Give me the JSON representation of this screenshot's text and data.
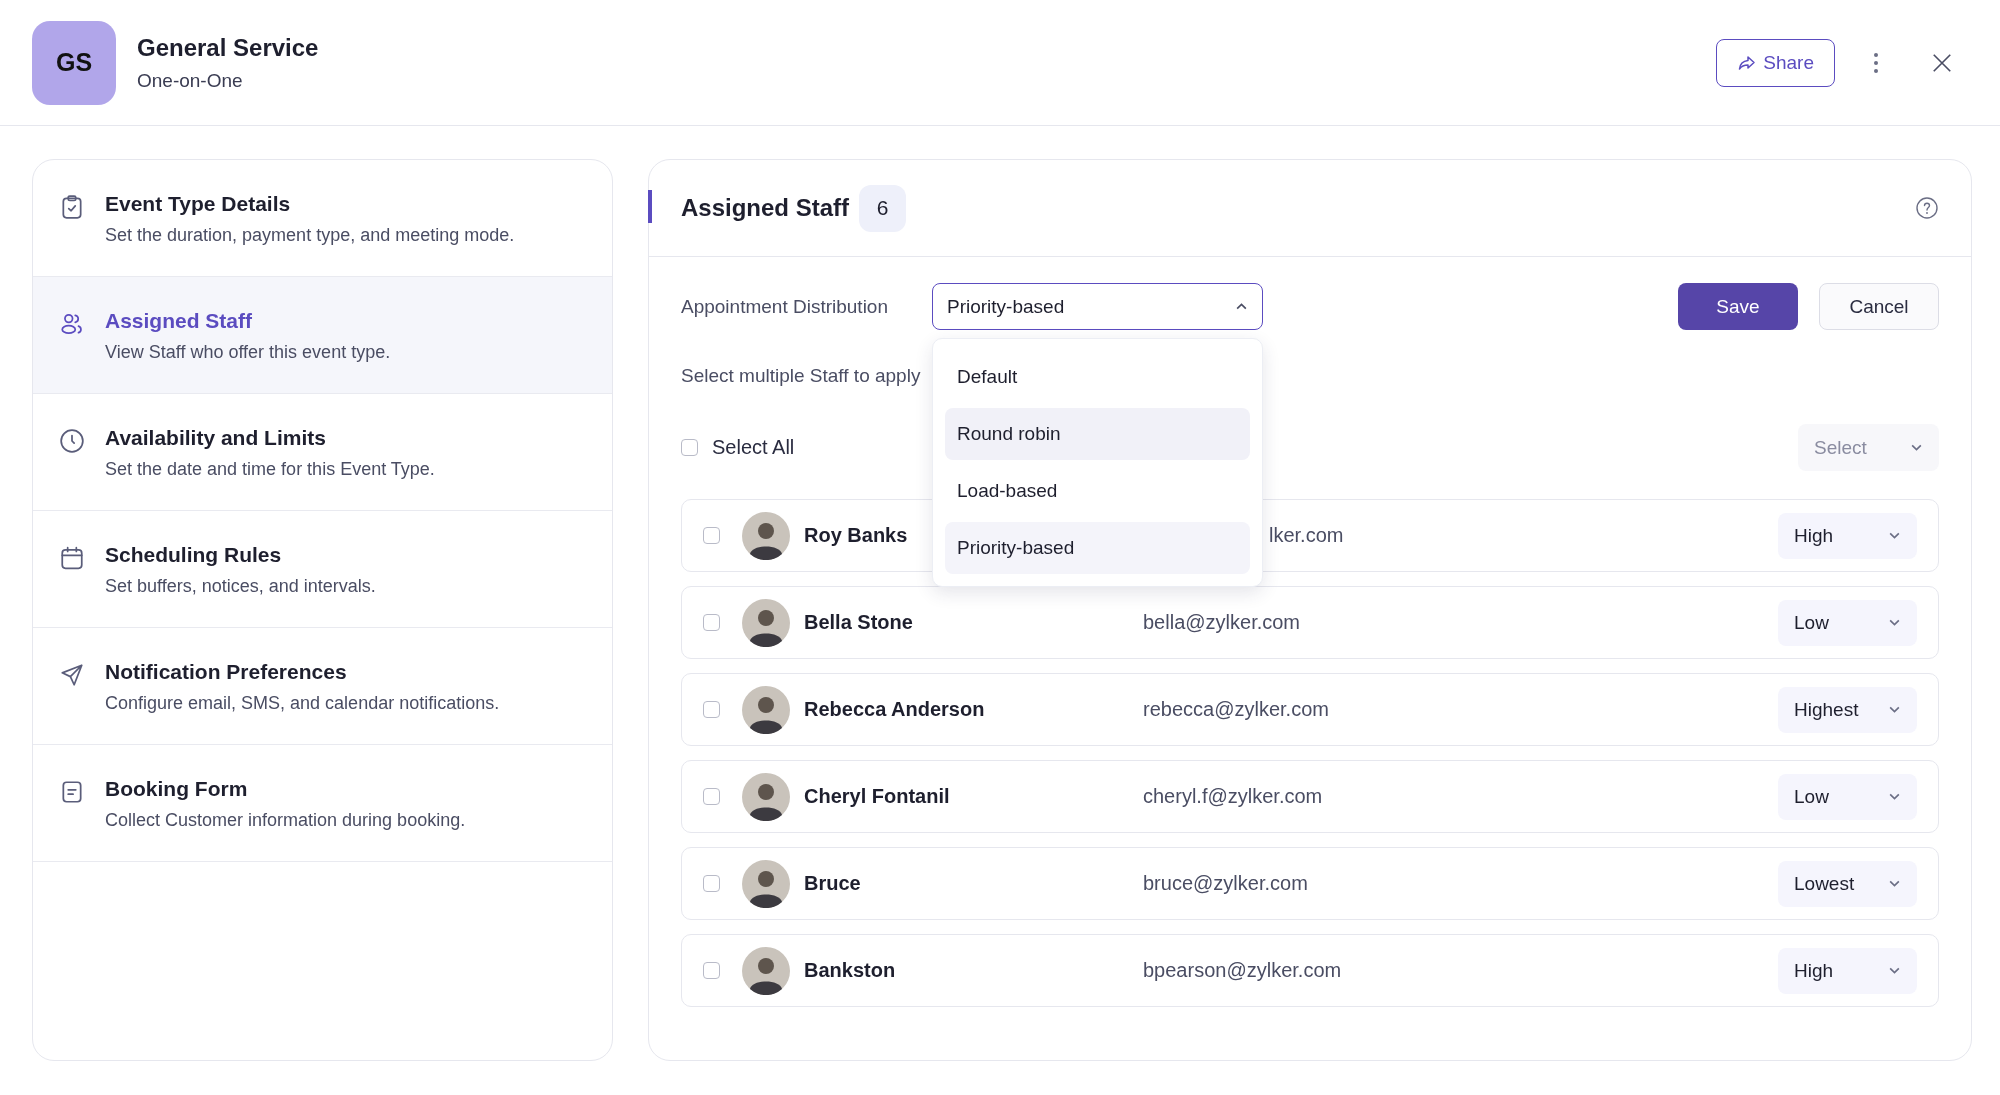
{
  "header": {
    "avatar": "GS",
    "title": "General Service",
    "subtitle": "One-on-One",
    "share_button": "Share"
  },
  "sidebar": {
    "items": [
      {
        "kind": "clipboard",
        "title": "Event Type Details",
        "description": "Set the duration, payment type, and meeting mode.",
        "selected": false
      },
      {
        "kind": "users",
        "title": "Assigned Staff",
        "description": "View Staff who offer this event type.",
        "selected": true
      },
      {
        "kind": "clock",
        "title": "Availability and Limits",
        "description": "Set the date and time for this Event Type.",
        "selected": false
      },
      {
        "kind": "calendar",
        "title": "Scheduling Rules",
        "description": "Set buffers, notices, and intervals.",
        "selected": false
      },
      {
        "kind": "send",
        "title": "Notification Preferences",
        "description": "Configure email, SMS, and calendar notifications.",
        "selected": false
      },
      {
        "kind": "form",
        "title": "Booking Form",
        "description": "Collect Customer information during booking.",
        "selected": false
      }
    ]
  },
  "panel": {
    "title": "Assigned Staff",
    "count": "6",
    "distribution": {
      "label": "Appointment Distribution",
      "value": "Priority-based",
      "expanded": true,
      "options": [
        {
          "label": "Default",
          "selected": false,
          "hovered": false
        },
        {
          "label": "Round robin",
          "selected": false,
          "hovered": true
        },
        {
          "label": "Load-based",
          "selected": false,
          "hovered": false
        },
        {
          "label": "Priority-based",
          "selected": true,
          "hovered": false
        }
      ]
    },
    "save_button": "Save",
    "cancel_button": "Cancel",
    "hint": "Select multiple Staff to apply",
    "select_all": {
      "label": "Select All",
      "checked": false
    },
    "bulk_select": {
      "placeholder": "Select"
    },
    "staff": [
      {
        "name": "Roy Banks",
        "email": "lker.com",
        "kind": "covered",
        "priority": "High",
        "checked": false
      },
      {
        "name": "Bella Stone",
        "email": "bella@zylker.com",
        "kind": "plain",
        "priority": "Low",
        "checked": false
      },
      {
        "name": "Rebecca Anderson",
        "email": "rebecca@zylker.com",
        "kind": "plain",
        "priority": "Highest",
        "checked": false
      },
      {
        "name": "Cheryl Fontanil",
        "email": "cheryl.f@zylker.com",
        "kind": "plain",
        "priority": "Low",
        "checked": false
      },
      {
        "name": "Bruce",
        "email": "bruce@zylker.com",
        "kind": "plain",
        "priority": "Lowest",
        "checked": false
      },
      {
        "name": "Bankston",
        "email": "bpearson@zylker.com",
        "kind": "plain",
        "priority": "High",
        "checked": false
      }
    ]
  }
}
